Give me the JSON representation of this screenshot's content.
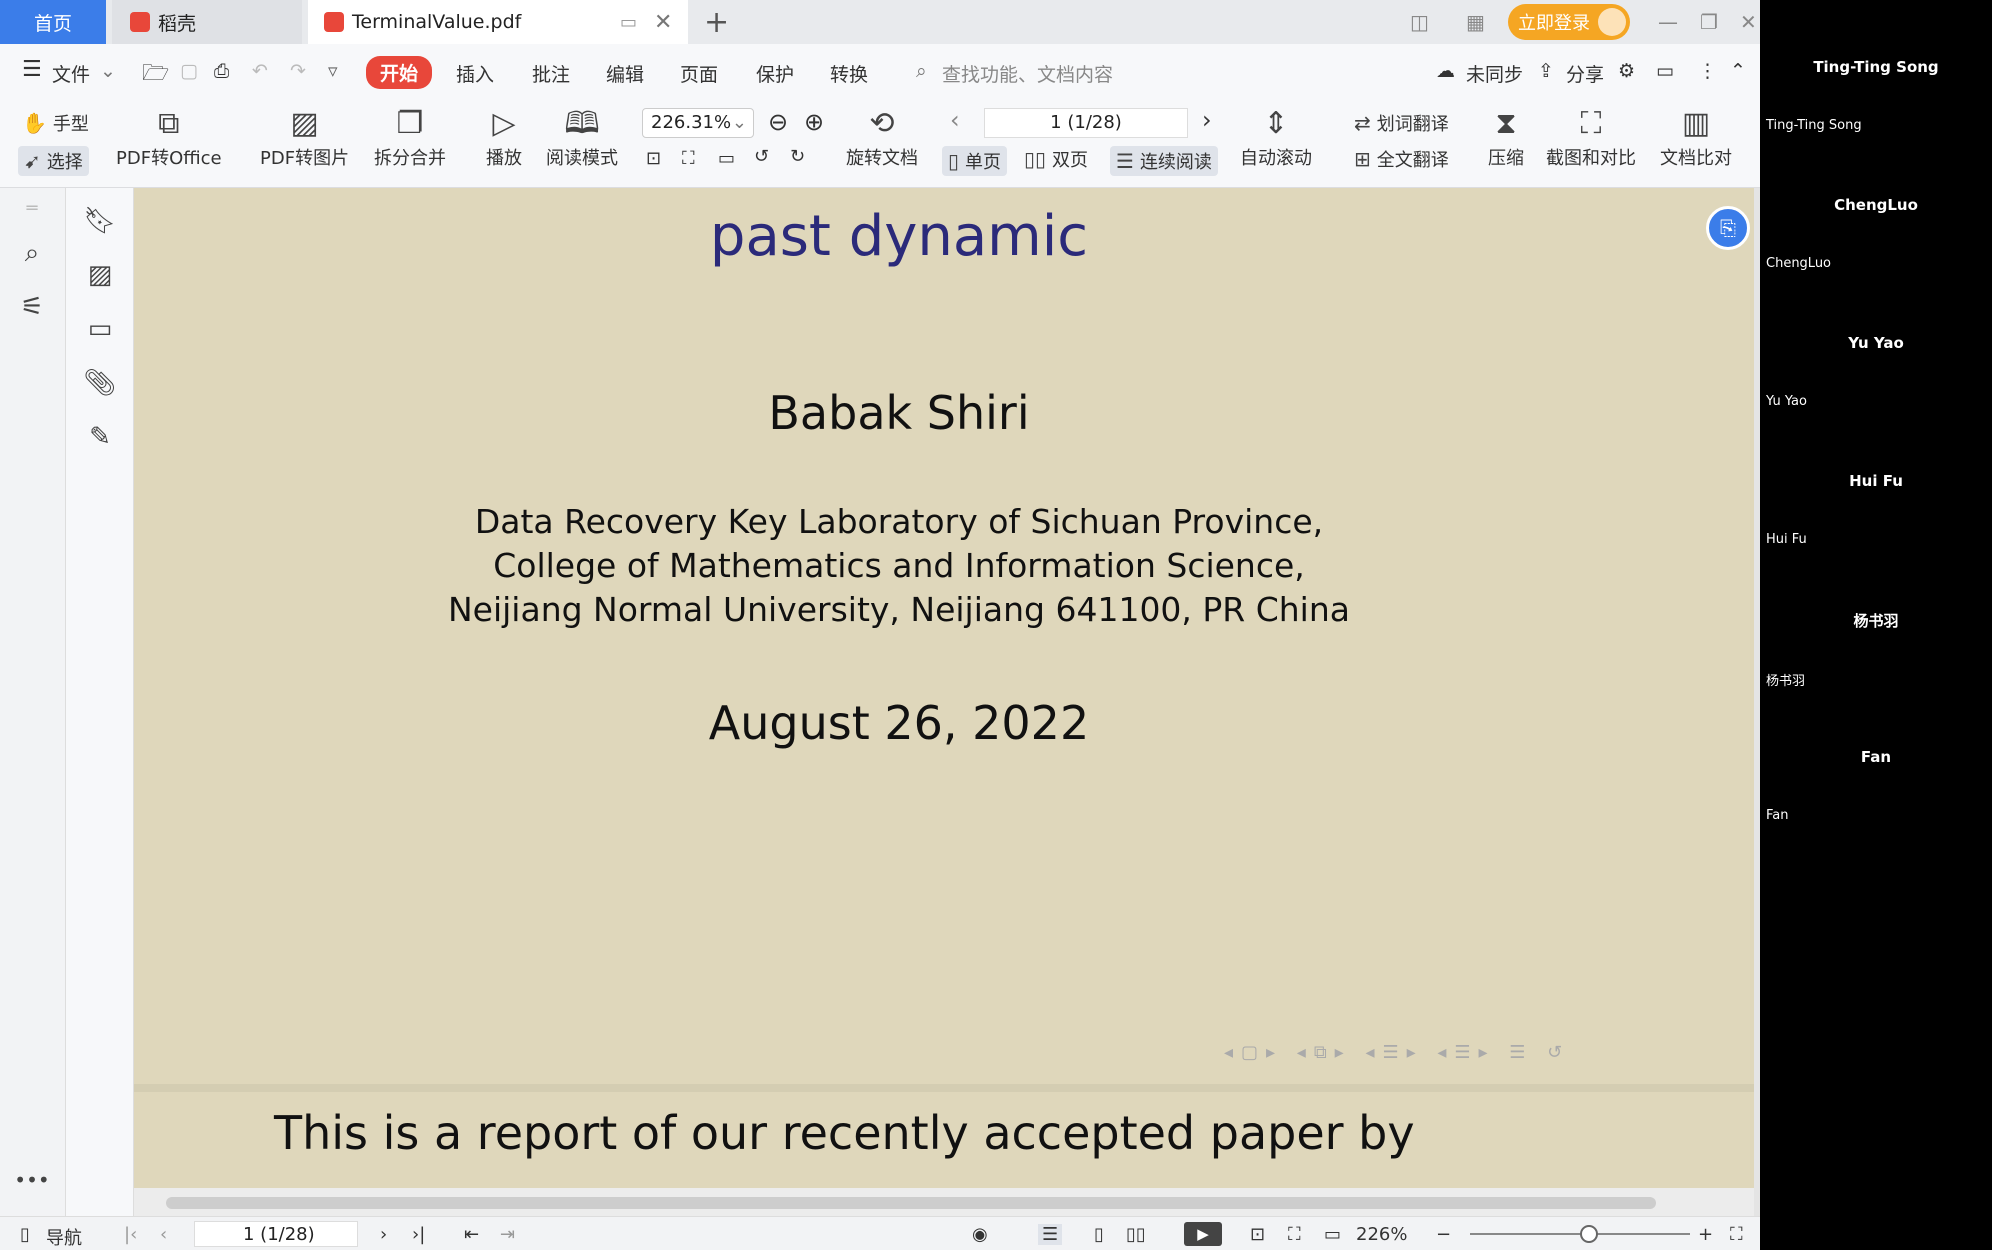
{
  "tabs": {
    "home": "首页",
    "daoke": "稻壳",
    "file": "TerminalValue.pdf",
    "new_tab": "+",
    "login": "立即登录"
  },
  "menu": {
    "file": "文件",
    "start": "开始",
    "insert": "插入",
    "annotate": "批注",
    "edit": "编辑",
    "page": "页面",
    "protect": "保护",
    "convert": "转换",
    "search_placeholder": "查找功能、文档内容",
    "sync": "未同步",
    "share": "分享"
  },
  "ribbon": {
    "hand": "手型",
    "select": "选择",
    "pdf_to_office": "PDF转Office",
    "pdf_to_image": "PDF转图片",
    "split_merge": "拆分合并",
    "play": "播放",
    "read_mode": "阅读模式",
    "zoom": "226.31%",
    "rotate": "旋转文档",
    "page_indicator": "1 (1/28)",
    "single_page": "单页",
    "double_page": "双页",
    "continuous": "连续阅读",
    "auto_scroll": "自动滚动",
    "word_translate": "划词翻译",
    "full_translate": "全文翻译",
    "compress": "压缩",
    "screenshot_compare": "截图和对比",
    "doc_compare": "文档比对"
  },
  "document": {
    "title": "past dynamic",
    "author": "Babak Shiri",
    "affiliation_1": "Data Recovery Key Laboratory of Sichuan Province,",
    "affiliation_2": "College of Mathematics and Information Science,",
    "affiliation_3": "Neijiang Normal University, Neijiang 641100, PR China",
    "date": "August 26, 2022",
    "next_slide_text": "This is a report of our recently accepted paper by"
  },
  "status": {
    "nav": "导航",
    "page": "1 (1/28)",
    "zoom": "226%"
  },
  "participants": [
    {
      "name": "Ting-Ting Song",
      "label": "Ting-Ting Song"
    },
    {
      "name": "ChengLuo",
      "label": "ChengLuo"
    },
    {
      "name": "Yu Yao",
      "label": "Yu Yao"
    },
    {
      "name": "Hui Fu",
      "label": "Hui Fu"
    },
    {
      "name": "杨书羽",
      "label": "杨书羽"
    },
    {
      "name": "Fan",
      "label": "Fan"
    }
  ],
  "colors": {
    "accent": "#e8473a",
    "login": "#f5a623",
    "slide_bg": "#dfd7bb",
    "slide_title": "#2b2a7a"
  }
}
